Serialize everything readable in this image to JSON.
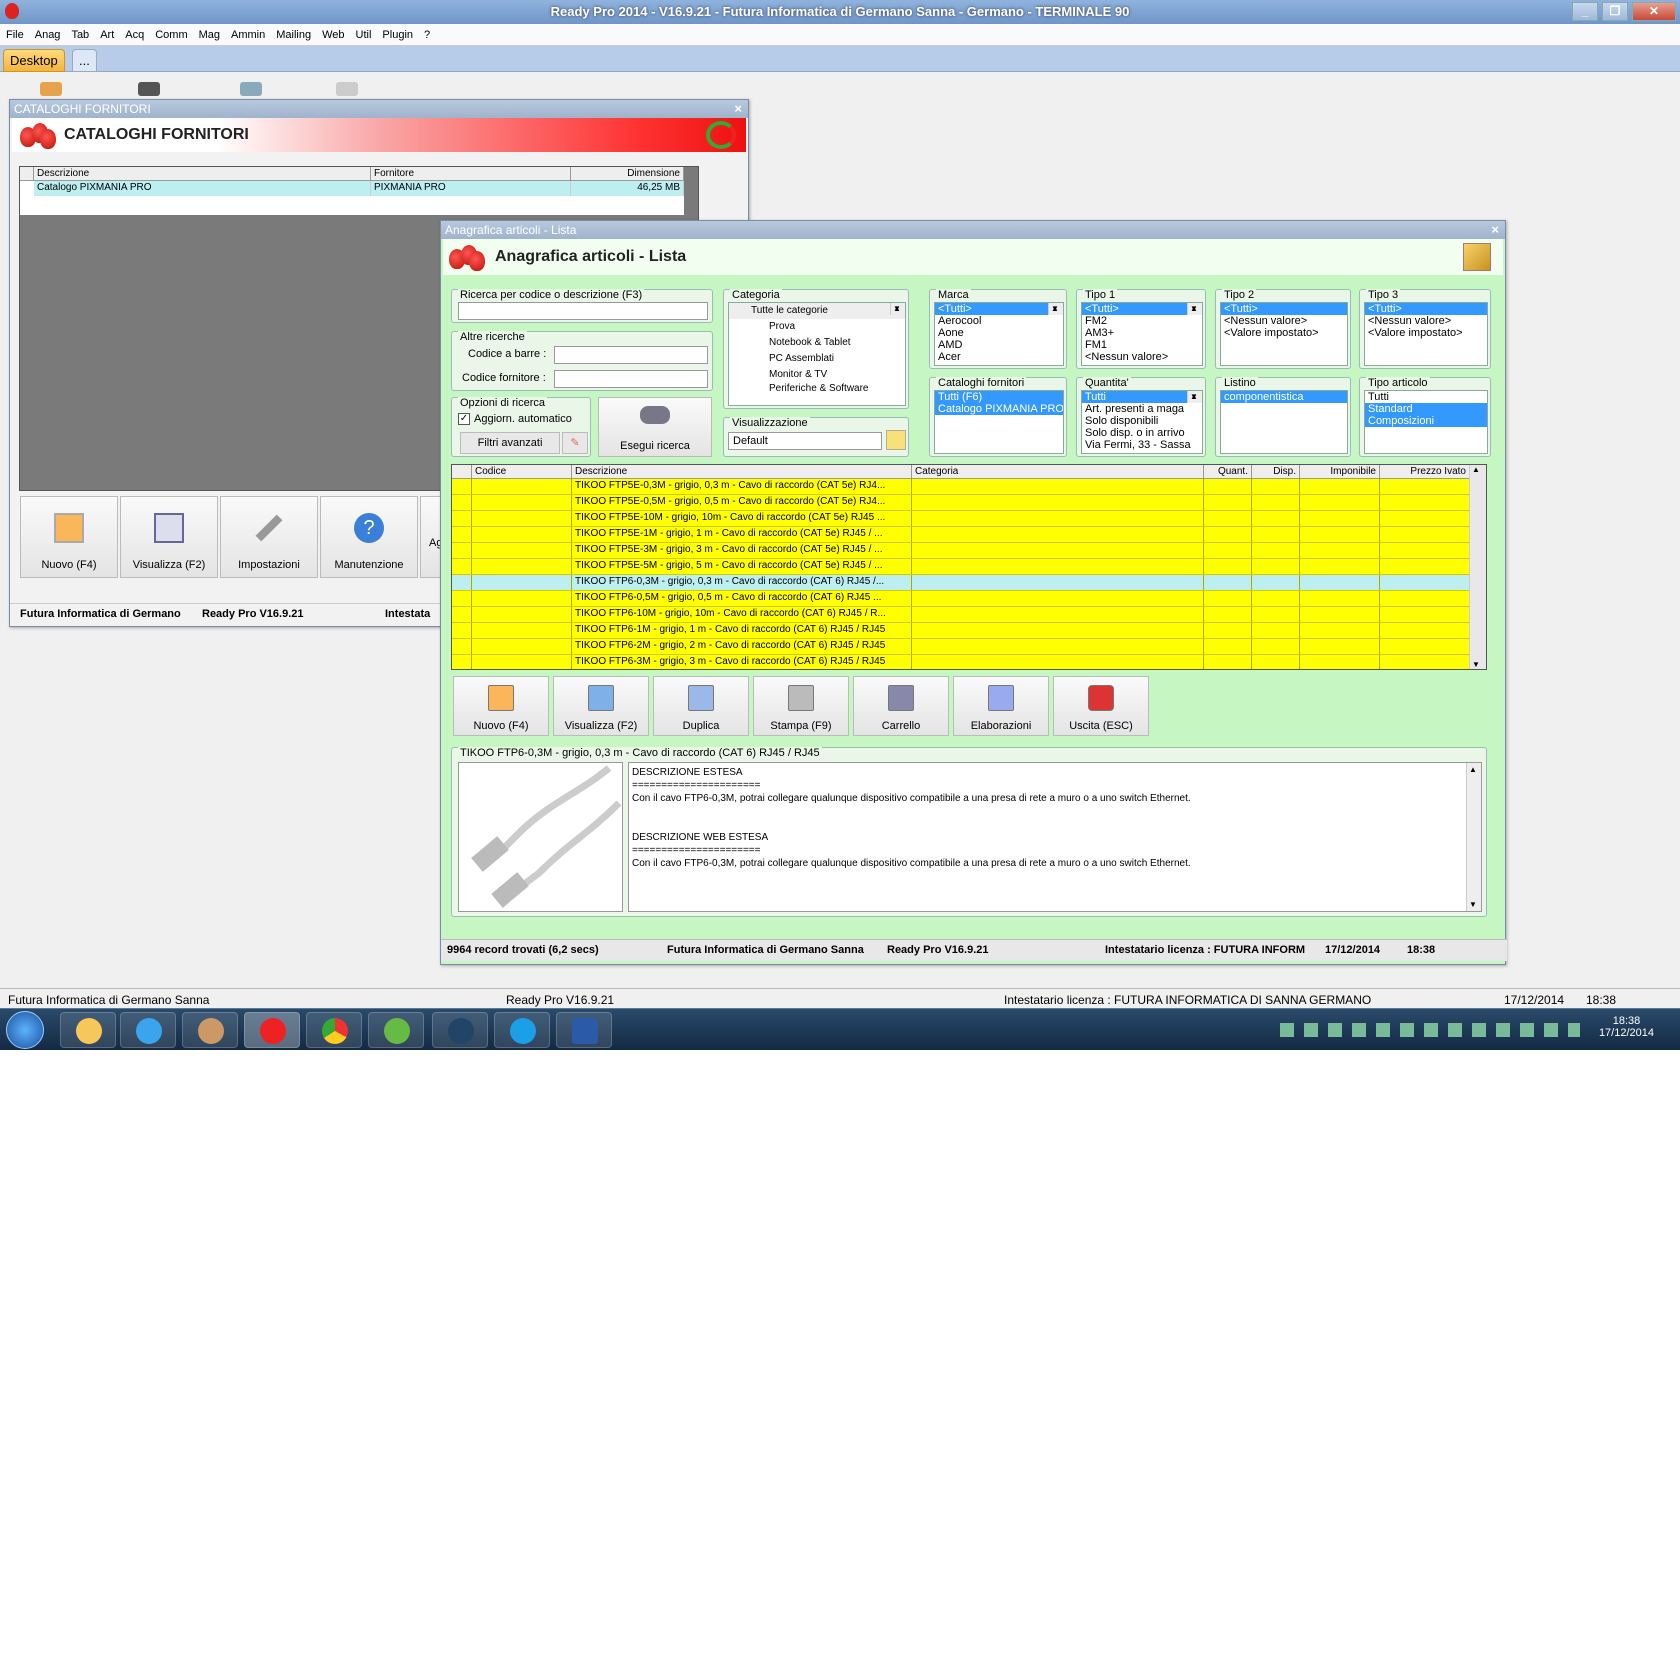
{
  "app_title": "Ready Pro 2014 - V16.9.21 - Futura Informatica di Germano Sanna - Germano - TERMINALE 90",
  "menu": [
    "File",
    "Anag",
    "Tab",
    "Art",
    "Acq",
    "Comm",
    "Mag",
    "Ammin",
    "Mailing",
    "Web",
    "Util",
    "Plugin",
    "?"
  ],
  "tabs": {
    "desktop": "Desktop",
    "more": "..."
  },
  "win1": {
    "title": "CATALOGHI FORNITORI",
    "header": "CATALOGHI FORNITORI",
    "close": "×",
    "columns": [
      "Descrizione",
      "Fornitore",
      "Dimensione"
    ],
    "rows": [
      [
        "Catalogo PIXMANIA PRO",
        "PIXMANIA PRO",
        "46,25 MB"
      ]
    ],
    "buttons": [
      "Nuovo (F4)",
      "Visualizza (F2)",
      "Impostazioni",
      "Manutenzione",
      "Ag"
    ],
    "status": [
      "Futura Informatica di Germano",
      "Ready Pro V16.9.21",
      "Intestata"
    ]
  },
  "win2": {
    "title": "Anagrafica articoli  - Lista",
    "header": "Anagrafica articoli  - Lista",
    "close": "×",
    "search_label": "Ricerca per codice o descrizione (F3)",
    "altre_label": "Altre ricerche",
    "barcode_label": "Codice a barre :",
    "codforn_label": "Codice fornitore :",
    "opzioni_label": "Opzioni di ricerca",
    "auto_label": "Aggiorn. automatico",
    "filtri_label": "Filtri avanzati",
    "esegui_label": "Esegui ricerca",
    "categoria_label": "Categoria",
    "categorie": [
      "Tutte le categorie",
      "Prova",
      "Notebook & Tablet",
      "PC Assemblati",
      "Monitor & TV",
      "Periferiche & Software"
    ],
    "visual_label": "Visualizzazione",
    "visual_value": "Default",
    "marca_label": "Marca",
    "marca": [
      "<Tutti>",
      "Aerocool",
      "Aone",
      "AMD",
      "Acer"
    ],
    "tipo1_label": "Tipo 1",
    "tipo1": [
      "<Tutti>",
      "FM2",
      "AM3+",
      "FM1",
      "<Nessun valore>"
    ],
    "tipo2_label": "Tipo 2",
    "tipo2": [
      "<Tutti>",
      "<Nessun valore>",
      "<Valore impostato>"
    ],
    "tipo3_label": "Tipo 3",
    "tipo3": [
      "<Tutti>",
      "<Nessun valore>",
      "<Valore impostato>"
    ],
    "catforn_label": "Cataloghi fornitori",
    "catforn": [
      "Tutti (F6)",
      "Catalogo PIXMANIA PRO"
    ],
    "quantita_label": "Quantita'",
    "quantita": [
      "Tutti",
      "Art. presenti a maga",
      "Solo disponibili",
      "Solo disp. o in arrivo",
      "Via Fermi, 33 - Sassa"
    ],
    "listino_label": "Listino",
    "listino": [
      "componentistica"
    ],
    "tipoart_label": "Tipo articolo",
    "tipoart": [
      "Tutti",
      "Standard",
      "Composizioni"
    ],
    "columns": [
      "Codice",
      "Descrizione",
      "Categoria",
      "Quant.",
      "Disp.",
      "Imponibile",
      "Prezzo Ivato"
    ],
    "rows": [
      "TIKOO FTP5E-0,3M - grigio, 0,3 m - Cavo di raccordo (CAT 5e) RJ4...",
      "TIKOO FTP5E-0,5M - grigio, 0,5 m - Cavo di raccordo (CAT 5e) RJ4...",
      "TIKOO FTP5E-10M - grigio, 10m - Cavo di raccordo (CAT 5e) RJ45 ...",
      "TIKOO FTP5E-1M - grigio, 1 m - Cavo di raccordo (CAT 5e) RJ45 / ...",
      "TIKOO FTP5E-3M - grigio, 3 m - Cavo di raccordo (CAT 5e) RJ45 / ...",
      "TIKOO FTP5E-5M - grigio, 5 m - Cavo di raccordo (CAT 5e) RJ45 / ...",
      "TIKOO FTP6-0,3M - grigio, 0,3 m - Cavo di raccordo (CAT 6) RJ45 /...",
      "TIKOO FTP6-0,5M  - grigio, 0,5 m - Cavo di raccordo (CAT 6) RJ45 ...",
      "TIKOO FTP6-10M - grigio, 10m - Cavo di raccordo (CAT 6) RJ45 / R...",
      "TIKOO FTP6-1M - grigio, 1 m - Cavo di raccordo (CAT 6) RJ45 / RJ45",
      "TIKOO FTP6-2M - grigio, 2 m - Cavo di raccordo (CAT 6) RJ45 / RJ45",
      "TIKOO FTP6-3M - grigio, 3 m - Cavo di raccordo (CAT 6) RJ45 / RJ45"
    ],
    "buttons": [
      "Nuovo (F4)",
      "Visualizza (F2)",
      "Duplica",
      "Stampa (F9)",
      "Carrello",
      "Elaborazioni",
      "Uscita (ESC)"
    ],
    "detail_title": "TIKOO FTP6-0,3M - grigio, 0,3 m - Cavo di raccordo (CAT 6) RJ45 / RJ45",
    "detail_lines": [
      "DESCRIZIONE ESTESA",
      "======================",
      "Con il cavo FTP6-0,3M, potrai collegare qualunque dispositivo compatibile a una presa di rete a muro o a uno switch Ethernet.",
      "",
      "",
      "DESCRIZIONE WEB ESTESA",
      "======================",
      "Con il cavo FTP6-0,3M, potrai collegare qualunque dispositivo compatibile a una presa di rete a muro o a uno switch Ethernet."
    ],
    "status": [
      "9964 record trovati (6,2 secs)",
      "Futura Informatica di Germano Sanna",
      "Ready Pro V16.9.21",
      "Intestatario licenza : FUTURA INFORM",
      "17/12/2014",
      "18:38"
    ]
  },
  "main_status": [
    "Futura Informatica di Germano Sanna",
    "Ready Pro V16.9.21",
    "Intestatario licenza : FUTURA INFORMATICA DI SANNA GERMANO",
    "17/12/2014",
    "18:38"
  ],
  "taskbar": {
    "time": "18:38",
    "date": "17/12/2014"
  },
  "colors": {
    "row_yellow": "#ffff00",
    "row_selected": "#bdeef0",
    "panel_green": "#c6f7c2"
  }
}
